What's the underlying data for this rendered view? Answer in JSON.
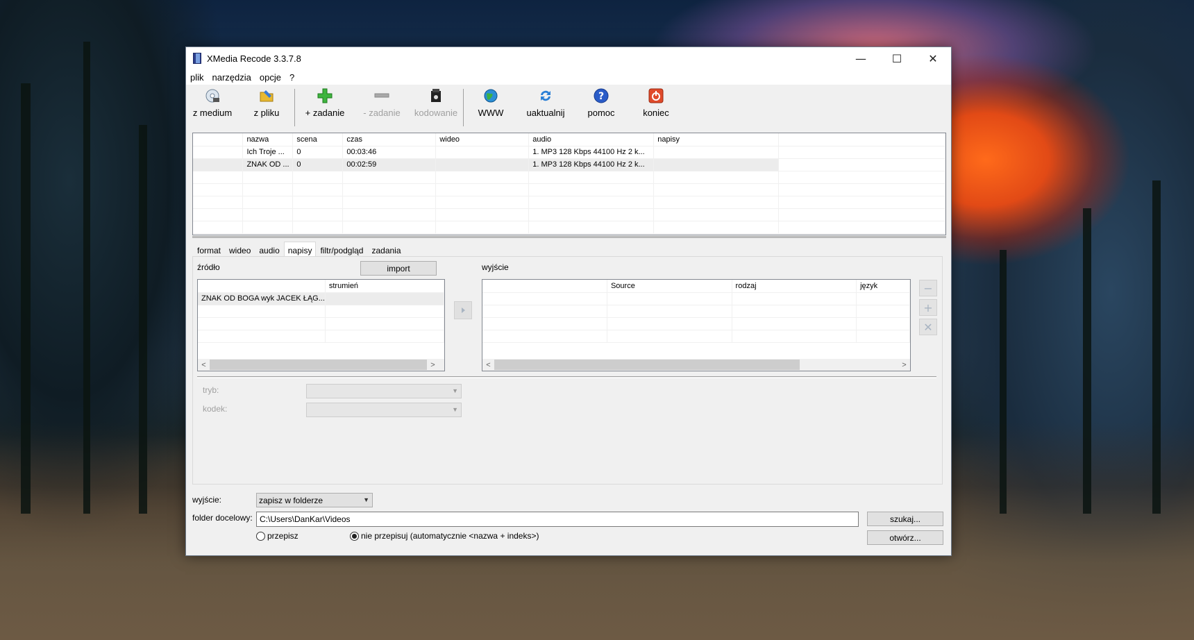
{
  "window": {
    "title": "XMedia Recode 3.3.7.8",
    "minimize": "—",
    "maximize": "☐",
    "close": "✕"
  },
  "menu": [
    "plik",
    "narzędzia",
    "opcje",
    "?"
  ],
  "toolbar": {
    "z_medium": "z medium",
    "z_pliku": "z pliku",
    "add_job": "+ zadanie",
    "remove_job": "- zadanie",
    "encode": "kodowanie",
    "www": "WWW",
    "update": "uaktualnij",
    "help": "pomoc",
    "exit": "koniec"
  },
  "file_list": {
    "headers": [
      "",
      "nazwa",
      "scena",
      "czas",
      "wideo",
      "audio",
      "napisy",
      ""
    ],
    "rows": [
      [
        "",
        "Ich Troje ...",
        "0",
        "00:03:46",
        "",
        "1. MP3 128 Kbps 44100 Hz 2 k...",
        "",
        ""
      ],
      [
        "",
        "ZNAK OD ...",
        "0",
        "00:02:59",
        "",
        "1. MP3 128 Kbps 44100 Hz 2 k...",
        "",
        ""
      ]
    ],
    "selected_row": 1
  },
  "tabs": [
    "format",
    "wideo",
    "audio",
    "napisy",
    "filtr/podgląd",
    "zadania"
  ],
  "active_tab": "napisy",
  "subtitles": {
    "source_label": "źródło",
    "import_button": "import",
    "source_headers": [
      "",
      "strumień"
    ],
    "source_rows": [
      [
        "ZNAK OD BOGA wyk JACEK ŁĄG...",
        ""
      ]
    ],
    "output_label": "wyjście",
    "output_headers": [
      "",
      "Source",
      "rodzaj",
      "język"
    ],
    "mode_label": "tryb:",
    "codec_label": "kodek:"
  },
  "bottom": {
    "output_label": "wyjście:",
    "output_value": "zapisz w folderze",
    "folder_label": "folder docelowy:",
    "folder_value": "C:\\Users\\DanKar\\Videos",
    "browse_button": "szukaj...",
    "open_button": "otwórz...",
    "radio_overwrite": "przepisz",
    "radio_no_overwrite": "nie przepisuj (automatycznie <nazwa + indeks>)",
    "overwrite_selected": false
  },
  "colors": {
    "accent_add": "#2e9e2e",
    "accent_exit": "#e04a2a",
    "help_blue": "#2a5cc8"
  }
}
